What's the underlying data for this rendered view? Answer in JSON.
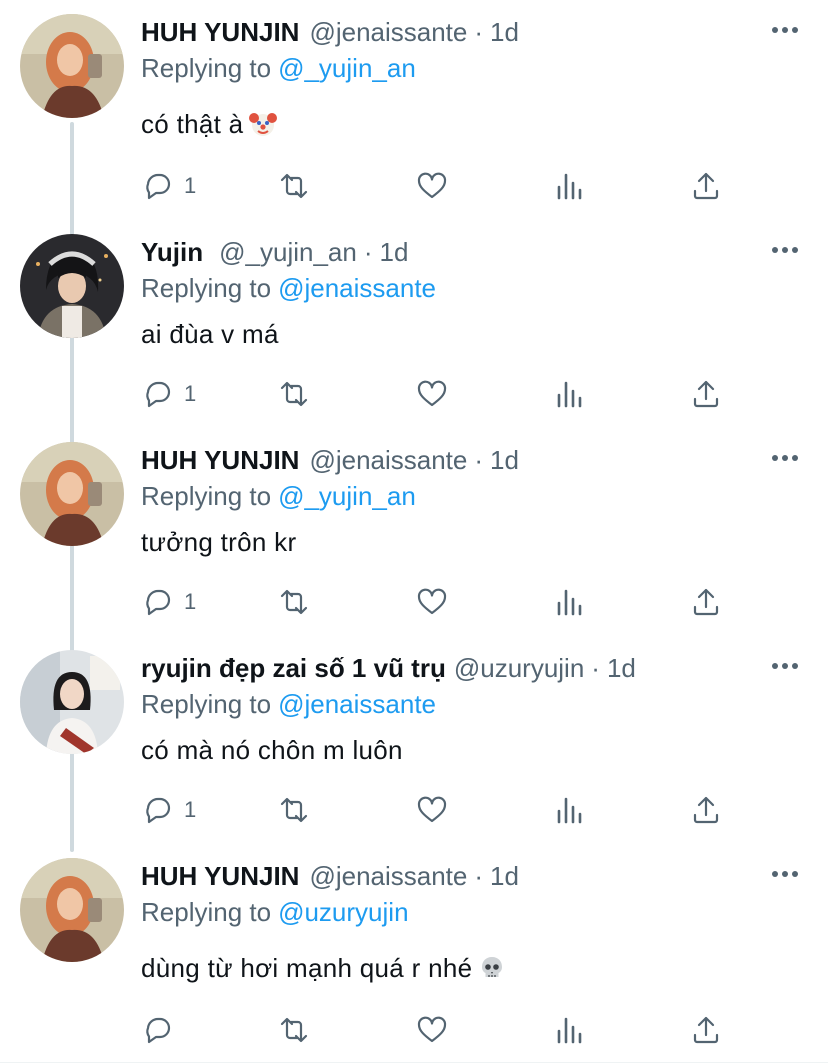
{
  "replies": [
    {
      "name": "HUH YUNJIN",
      "handle": "@jenaissante",
      "time": "1d",
      "replying_prefix": "Replying to",
      "replying_to": "@_yujin_an",
      "text": "có thật à",
      "emoji": "clown-face",
      "reply_count": "1",
      "avatar": "huh-yunjin-avatar"
    },
    {
      "name": "Yujin",
      "handle": "@_yujin_an",
      "time": "1d",
      "replying_prefix": "Replying to",
      "replying_to": "@jenaissante",
      "text": "ai đùa v má",
      "reply_count": "1",
      "avatar": "yujin-avatar"
    },
    {
      "name": "HUH YUNJIN",
      "handle": "@jenaissante",
      "time": "1d",
      "replying_prefix": "Replying to",
      "replying_to": "@_yujin_an",
      "text": "tưởng trôn kr",
      "reply_count": "1",
      "avatar": "huh-yunjin-avatar"
    },
    {
      "name": "ryujin đẹp zai số 1 vũ trụ",
      "handle": "@uzuryujin",
      "time": "1d",
      "replying_prefix": "Replying to",
      "replying_to": "@jenaissante",
      "text": "có mà nó chôn m luôn",
      "reply_count": "1",
      "avatar": "ryujin-avatar"
    },
    {
      "name": "HUH YUNJIN",
      "handle": "@jenaissante",
      "time": "1d",
      "replying_prefix": "Replying to",
      "replying_to": "@uzuryujin",
      "text": "dùng từ hơi mạnh quá r nhé",
      "emoji": "skull",
      "reply_count": "",
      "avatar": "huh-yunjin-avatar"
    }
  ],
  "icons": [
    "reply-icon",
    "retweet-icon",
    "like-icon",
    "analytics-icon",
    "share-icon",
    "more-icon"
  ],
  "colors": {
    "link": "#1d9bf0",
    "muted": "#536471",
    "text": "#0f1419",
    "thread_line": "#cfd9de"
  }
}
